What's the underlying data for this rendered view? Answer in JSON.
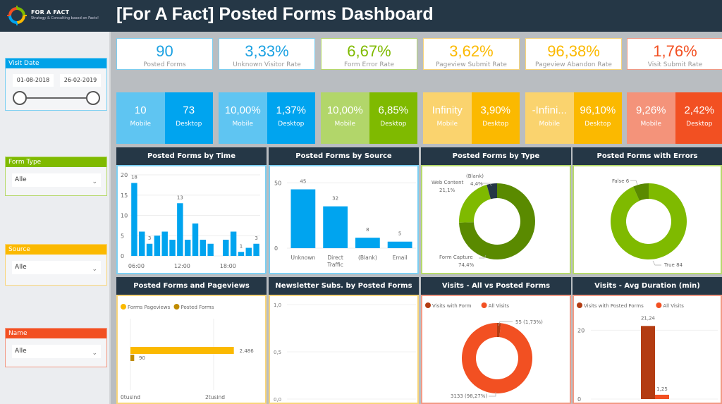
{
  "header": {
    "brand_name": "FOR A FACT",
    "brand_tagline": "Strategy & Consulting based on Facts!",
    "title": "[For A Fact] Posted Forms Dashboard"
  },
  "slicers": {
    "visit_date": {
      "label": "Visit Date",
      "start": "01-08-2018",
      "end": "26-02-2019",
      "color": "#00a2e8"
    },
    "form_type": {
      "label": "Form Type",
      "value": "Alle",
      "color": "#7fba00"
    },
    "source": {
      "label": "Source",
      "value": "Alle",
      "color": "#fbb900"
    },
    "name": {
      "label": "Name",
      "value": "Alle",
      "color": "#f25022"
    }
  },
  "kpis": [
    {
      "value": "90",
      "label": "Posted Forms",
      "color": "#1ba1e2",
      "border": "#7ccff2",
      "mobile": "10",
      "desktop": "73",
      "mobile_bg": "#5fc5f2",
      "desktop_bg": "#00a4ef"
    },
    {
      "value": "3,33%",
      "label": "Unknown Visitor Rate",
      "color": "#1ba1e2",
      "border": "#7ccff2",
      "mobile": "10,00%",
      "desktop": "1,37%",
      "mobile_bg": "#5fc5f2",
      "desktop_bg": "#00a4ef"
    },
    {
      "value": "6,67%",
      "label": "Form Error Rate",
      "color": "#7fba00",
      "border": "#b6d96b",
      "mobile": "10,00%",
      "desktop": "6,85%",
      "mobile_bg": "#b2d66a",
      "desktop_bg": "#7fba00"
    },
    {
      "value": "3,62%",
      "label": "Pageview Submit Rate",
      "color": "#fbb900",
      "border": "#f8d57a",
      "mobile": "Infinity",
      "desktop": "3,90%",
      "mobile_bg": "#fad36e",
      "desktop_bg": "#fbb900"
    },
    {
      "value": "96,38%",
      "label": "Pageview Abandon Rate",
      "color": "#fbb900",
      "border": "#f8d57a",
      "mobile": "-Infini...",
      "desktop": "96,10%",
      "mobile_bg": "#fad36e",
      "desktop_bg": "#fbb900"
    },
    {
      "value": "1,76%",
      "label": "Visit Submit Rate",
      "color": "#f25022",
      "border": "#f29a85",
      "mobile": "9,26%",
      "desktop": "2,42%",
      "mobile_bg": "#f4937a",
      "desktop_bg": "#f25022"
    }
  ],
  "kpi_sub_labels": {
    "mobile": "Mobile",
    "desktop": "Desktop"
  },
  "panels": {
    "by_time": {
      "title": "Posted Forms by Time"
    },
    "by_source": {
      "title": "Posted Forms by Source"
    },
    "by_type": {
      "title": "Posted Forms by Type"
    },
    "with_errors": {
      "title": "Posted Forms with Errors"
    },
    "pageviews": {
      "title": "Posted Forms and Pageviews"
    },
    "newsletter": {
      "title": "Newsletter Subs. by Posted Forms"
    },
    "visits_all": {
      "title": "Visits - All vs Posted Forms"
    },
    "avg_duration": {
      "title": "Visits - Avg Duration (min)"
    }
  },
  "chart_data": [
    {
      "id": "by_time",
      "type": "bar",
      "title": "Posted Forms by Time",
      "x": [
        6,
        7,
        8,
        9,
        10,
        11,
        12,
        13,
        14,
        15,
        16,
        17,
        18,
        19,
        20,
        21,
        22
      ],
      "values": [
        18,
        6,
        3,
        5,
        6,
        4,
        13,
        4,
        8,
        4,
        3,
        0,
        4,
        6,
        1,
        2,
        3
      ],
      "data_labels": {
        "0": "18",
        "2": "3",
        "6": "13",
        "14": "1",
        "16": "3"
      },
      "xticks": [
        {
          "x": 6,
          "label": "06:00"
        },
        {
          "x": 12,
          "label": "12:00"
        },
        {
          "x": 18,
          "label": "18:00"
        }
      ],
      "yticks": [
        0,
        5,
        10,
        15,
        20
      ],
      "ylim": [
        0,
        20
      ],
      "color": "#00a4ef",
      "grid": true
    },
    {
      "id": "by_source",
      "type": "bar",
      "title": "Posted Forms by Source",
      "categories": [
        "Unknown",
        "Direct Traffic",
        "(Blank)",
        "Email"
      ],
      "values": [
        45,
        32,
        8,
        5
      ],
      "yticks": [
        0,
        50
      ],
      "ylim": [
        0,
        55
      ],
      "color": "#00a4ef",
      "grid": true
    },
    {
      "id": "by_type",
      "type": "pie",
      "title": "Posted Forms by Type",
      "donut": true,
      "slices": [
        {
          "label": "Form Capture",
          "pct": "74,4%",
          "value": 74.4,
          "color": "#5a8a00"
        },
        {
          "label": "Web Content",
          "pct": "21,1%",
          "value": 21.1,
          "color": "#7fba00"
        },
        {
          "label": "(Blank)",
          "pct": "4,4%",
          "value": 4.4,
          "color": "#253746"
        }
      ]
    },
    {
      "id": "with_errors",
      "type": "pie",
      "title": "Posted Forms with Errors",
      "donut": true,
      "slices": [
        {
          "label": "True 84",
          "value": 84,
          "color": "#7fba00"
        },
        {
          "label": "False 6",
          "value": 6,
          "color": "#5a8a00"
        }
      ]
    },
    {
      "id": "pageviews",
      "type": "bar",
      "orientation": "horizontal",
      "title": "Posted Forms and Pageviews",
      "series": [
        {
          "name": "Forms Pageviews",
          "value": 2486,
          "label": "2.486",
          "color": "#fbb900"
        },
        {
          "name": "Posted Forms",
          "value": 90,
          "label": "90",
          "color": "#c08c00"
        }
      ],
      "xticks": [
        {
          "v": 0,
          "label": "0tusind"
        },
        {
          "v": 2000,
          "label": "2tusind"
        }
      ],
      "xlim": [
        0,
        2500
      ],
      "legend": "top-left"
    },
    {
      "id": "newsletter",
      "type": "line",
      "title": "Newsletter Subs. by Posted Forms",
      "series": [],
      "yticks": [
        "0,0",
        "0,5",
        "1,0"
      ],
      "ylim": [
        0,
        1
      ],
      "grid": true
    },
    {
      "id": "visits_all",
      "type": "pie",
      "title": "Visits - All vs Posted Forms",
      "donut": true,
      "legend": "top-left",
      "slices": [
        {
          "label": "Visits with Form",
          "text": "55 (1,73%)",
          "value": 55,
          "color": "#b33c12"
        },
        {
          "label": "All Visits",
          "text": "3133 (98,27%)",
          "value": 3133,
          "color": "#f25022"
        }
      ]
    },
    {
      "id": "avg_duration",
      "type": "bar",
      "title": "Visits - Avg Duration (min)",
      "legend": "top-left",
      "series": [
        {
          "name": "Visits with Posted Forms",
          "value": 21.24,
          "label": "21,24",
          "color": "#b33c12"
        },
        {
          "name": "All Visits",
          "value": 1.25,
          "label": "1,25",
          "color": "#f25022"
        }
      ],
      "yticks": [
        0,
        20
      ],
      "ylim": [
        0,
        25
      ],
      "grid": true
    }
  ]
}
